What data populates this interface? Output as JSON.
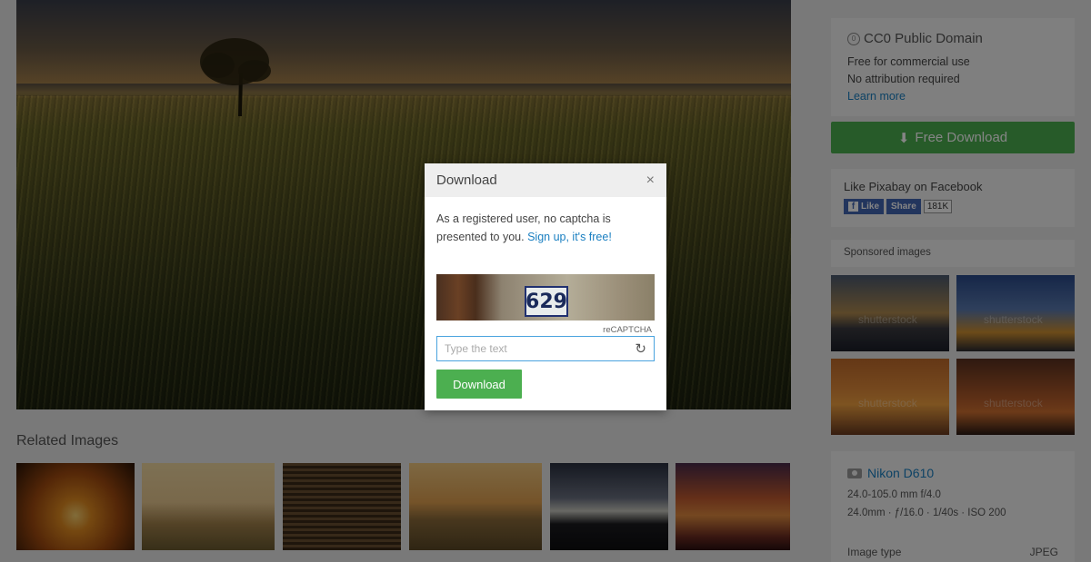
{
  "license": {
    "title": "CC0 Public Domain",
    "line1": "Free for commercial use",
    "line2": "No attribution required",
    "learn_more": "Learn more"
  },
  "download_button": "Free Download",
  "facebook": {
    "title": "Like Pixabay on Facebook",
    "like": "Like",
    "share": "Share",
    "count": "181K"
  },
  "sponsored": {
    "title": "Sponsored images",
    "watermark": "shutterstock"
  },
  "camera": {
    "model": "Nikon D610",
    "lens": "24.0-105.0 mm f/4.0",
    "settings": "24.0mm · ƒ/16.0 · 1/40s · ISO 200",
    "image_type_label": "Image type",
    "image_type_value": "JPEG"
  },
  "related_title": "Related Images",
  "modal": {
    "title": "Download",
    "close": "×",
    "message": "As a registered user, no captcha is presented to you.",
    "signup": "Sign up, it's free!",
    "captcha_number": "629",
    "recaptcha_label": "reCAPTCHA",
    "input_placeholder": "Type the text",
    "download": "Download"
  },
  "colors": {
    "accent_green": "#4caf50",
    "link_blue": "#1a7fc1",
    "facebook_blue": "#4267b2"
  }
}
